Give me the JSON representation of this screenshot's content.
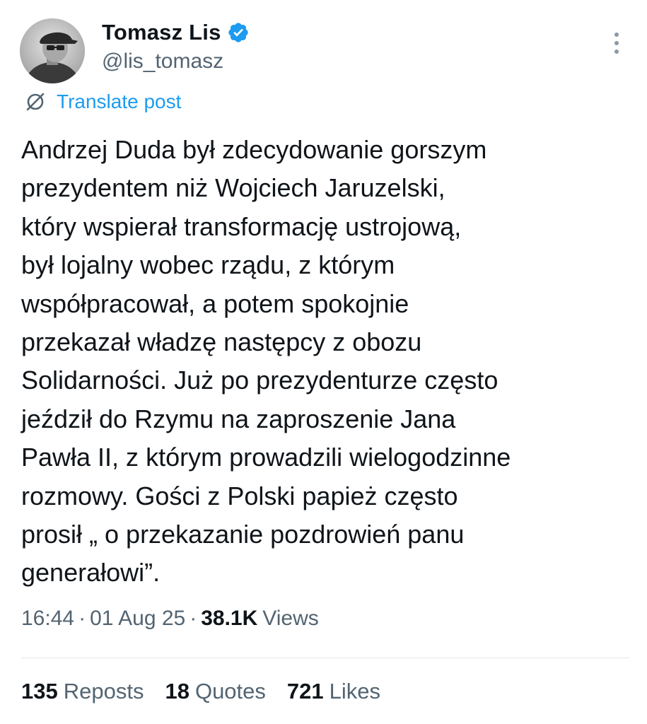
{
  "author": {
    "display_name": "Tomasz Lis",
    "handle": "@lis_tomasz",
    "verified": true,
    "avatar_icon": "user-photo-avatar"
  },
  "translate": {
    "label": "Translate post",
    "icon": "globe-slash-icon"
  },
  "tweet": {
    "lines": [
      "Andrzej Duda był zdecydowanie gorszym",
      "prezydentem niż Wojciech Jaruzelski,",
      "który wspierał transformację ustrojową,",
      "był lojalny wobec rządu, z którym",
      "współpracował, a potem spokojnie",
      "przekazał władzę następcy z obozu",
      "Solidarności. Już po prezydenturze często",
      "jeździł do Rzymu na zaproszenie Jana",
      "Pawła II, z którym prowadzili wielogodzinne",
      "rozmowy.  Gości z Polski papież często",
      "prosił „ o przekazanie pozdrowień panu",
      "generałowi”."
    ]
  },
  "meta": {
    "time": "16:44",
    "separator": "·",
    "date": "01 Aug 25",
    "views_count": "38.1K",
    "views_label": "Views"
  },
  "stats": {
    "reposts_count": "135",
    "reposts_label": "Reposts",
    "quotes_count": "18",
    "quotes_label": "Quotes",
    "likes_count": "721",
    "likes_label": "Likes"
  },
  "colors": {
    "text": "#0f1419",
    "secondary": "#536471",
    "link": "#1d9bf0",
    "verified": "#1d9bf0",
    "divider": "#e1e8ed"
  }
}
